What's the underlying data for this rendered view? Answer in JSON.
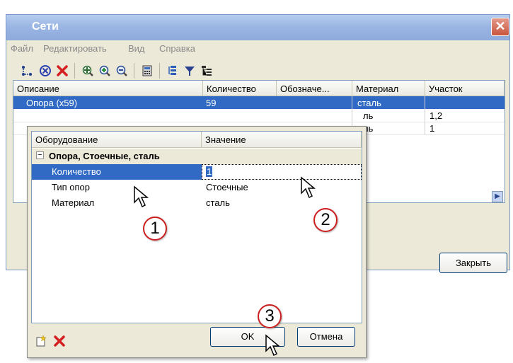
{
  "window": {
    "title": "Сети",
    "close_glyph": "✕"
  },
  "menu": [
    "Файл",
    "Редактировать",
    "Вид",
    "Справка"
  ],
  "toolbar": {
    "icons": [
      "network-node-icon",
      "cancel-circle-icon",
      "delete-icon",
      "pan-icon",
      "zoom-in-icon",
      "zoom-out-icon",
      "calculator-icon",
      "list-icon",
      "filter-icon",
      "tree-list-icon"
    ]
  },
  "grid": {
    "columns": [
      "Описание",
      "Количество",
      "Обозначе...",
      "Материал",
      "Участок"
    ],
    "rows": [
      {
        "description": "Опора (x59)",
        "quantity": "59",
        "designation": "",
        "material": "сталь",
        "section": ""
      },
      {
        "description": "",
        "quantity": "",
        "designation": "",
        "material": "ль",
        "section": "1,2"
      },
      {
        "description": "",
        "quantity": "",
        "designation": "",
        "material": "ль",
        "section": "1"
      }
    ]
  },
  "close_button": "Закрыть",
  "dialog": {
    "columns": [
      "Оборудование",
      "Значение"
    ],
    "category": "Опора, Стоечные, сталь",
    "rows": [
      {
        "label": "Количество",
        "value": "1"
      },
      {
        "label": "Тип опор",
        "value": "Стоечные"
      },
      {
        "label": "Материал",
        "value": "сталь"
      }
    ],
    "ok": "OK",
    "cancel": "Отмена"
  },
  "callouts": [
    "1",
    "2",
    "3"
  ],
  "colors": {
    "selection": "#316ac5",
    "callout_border": "#cc1f1f",
    "title_gradient": "#9bb6e3"
  }
}
